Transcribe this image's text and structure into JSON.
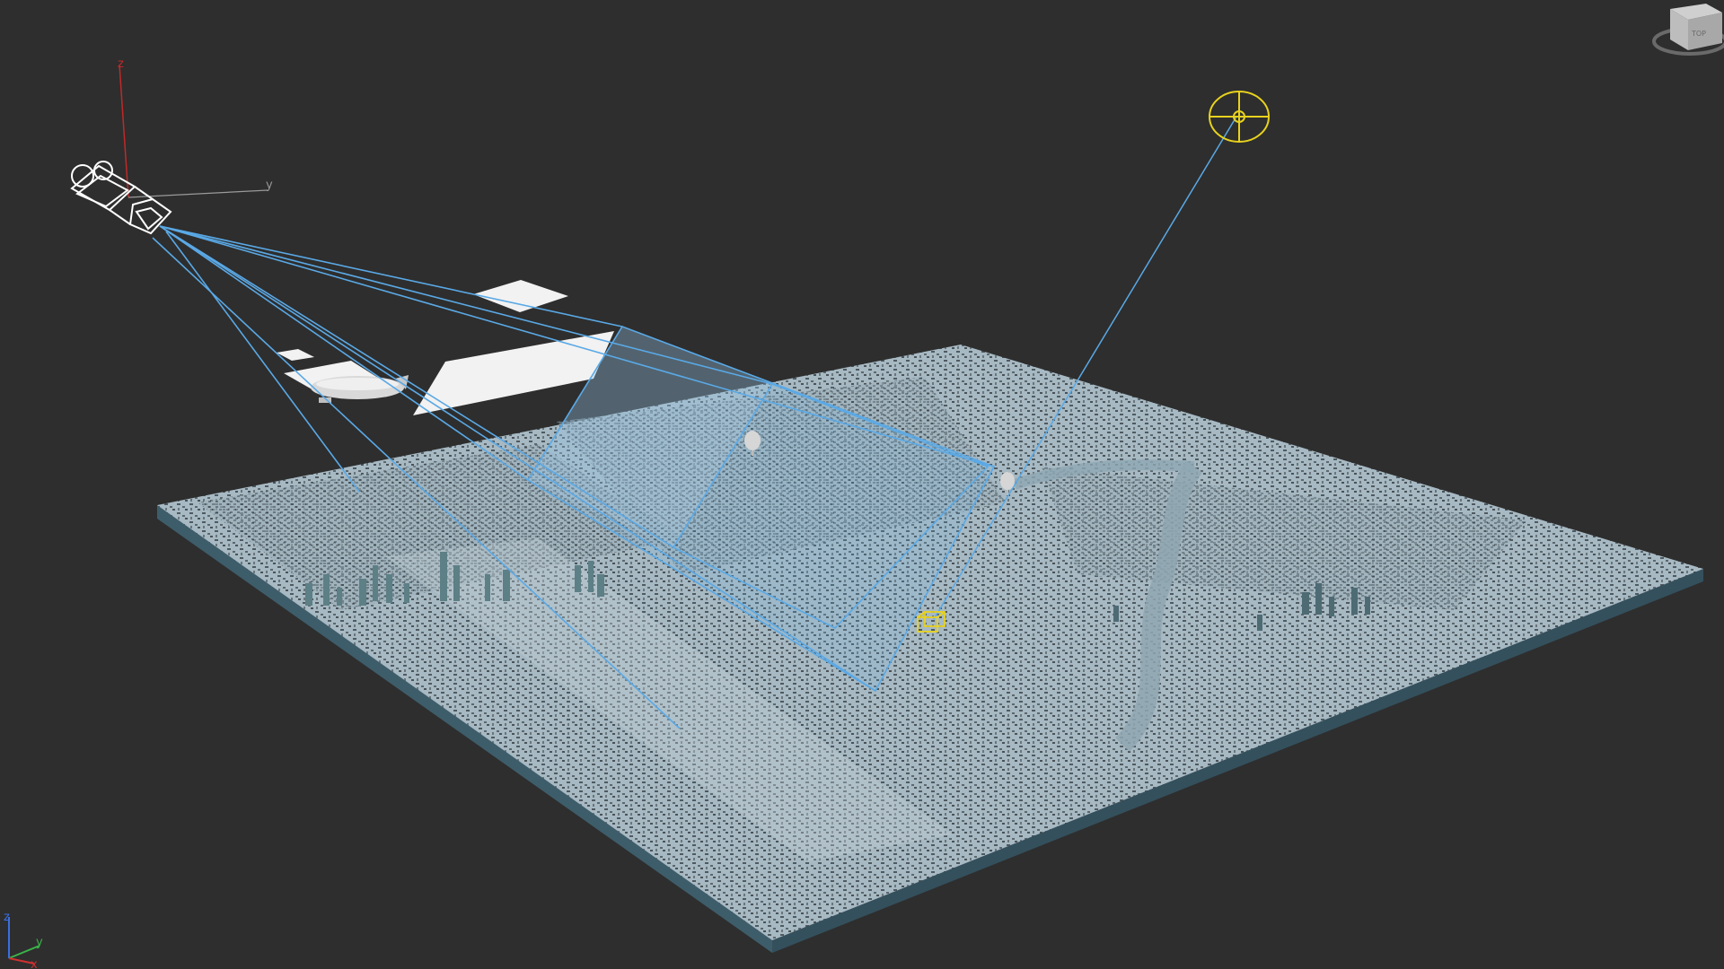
{
  "viewport": {
    "background": "#2e2e2e",
    "grid_visible": false
  },
  "scene": {
    "city_plane_top": "#a9bcc6",
    "city_plane_edge": "#40616f",
    "frustum_color": "#5aa9e6",
    "target_color": "#e8d21e",
    "camera_color": "#ffffff"
  },
  "camera_gizmo": {
    "z_label": "z",
    "y_label": "y",
    "z_color": "#c0292a",
    "y_color": "#9a9a9a"
  },
  "world_axis": {
    "x_label": "x",
    "y_label": "y",
    "z_label": "z",
    "x_color": "#d03030",
    "y_color": "#3ab44a",
    "z_color": "#3a6fe0"
  },
  "objects": {
    "camera": "camera-icon",
    "light_target": "target-light-icon",
    "airship": "airship",
    "balloons": [
      "balloon",
      "balloon"
    ]
  },
  "viewcube": {
    "face_label": "TOP"
  }
}
